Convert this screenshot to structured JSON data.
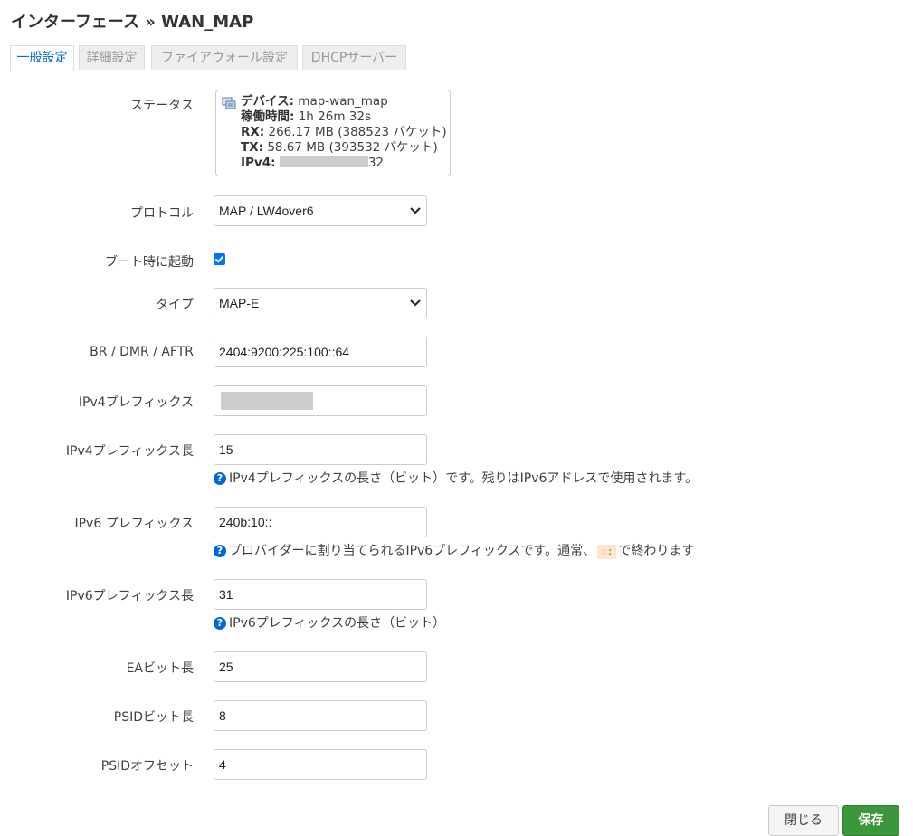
{
  "page": {
    "title": "インターフェース » WAN_MAP"
  },
  "tabs": [
    {
      "label": "一般設定"
    },
    {
      "label": "詳細設定"
    },
    {
      "label": "ファイアウォール設定"
    },
    {
      "label": "DHCPサーバー"
    }
  ],
  "status": {
    "label": "ステータス",
    "device_key": "デバイス:",
    "device_val": "map-wan_map",
    "uptime_key": "稼働時間:",
    "uptime_val": "1h 26m 32s",
    "rx_key": "RX:",
    "rx_val": "266.17 MB (388523 パケット)",
    "tx_key": "TX:",
    "tx_val": "58.67 MB (393532 パケット)",
    "ipv4_key": "IPv4:",
    "ipv4_suffix": "32"
  },
  "fields": {
    "protocol": {
      "label": "プロトコル",
      "value": "MAP / LW4over6"
    },
    "boot": {
      "label": "ブート時に起動",
      "checked": true
    },
    "type": {
      "label": "タイプ",
      "value": "MAP-E"
    },
    "br": {
      "label": "BR / DMR / AFTR",
      "value": "2404:9200:225:100::64"
    },
    "ipv4prefix": {
      "label": "IPv4プレフィックス"
    },
    "ipv4prefixlen": {
      "label": "IPv4プレフィックス長",
      "value": "15",
      "help": "IPv4プレフィックスの長さ（ビット）です。残りはIPv6アドレスで使用されます。"
    },
    "ipv6prefix": {
      "label": "IPv6 プレフィックス",
      "value": "240b:10::",
      "help_before": "プロバイダーに割り当てられるIPv6プレフィックスです。通常、",
      "help_code": "::",
      "help_after": "で終わります"
    },
    "ipv6prefixlen": {
      "label": "IPv6プレフィックス長",
      "value": "31",
      "help": "IPv6プレフィックスの長さ（ビット）"
    },
    "ealen": {
      "label": "EAビット長",
      "value": "25"
    },
    "psidlen": {
      "label": "PSIDビット長",
      "value": "8"
    },
    "psidoffset": {
      "label": "PSIDオフセット",
      "value": "4"
    }
  },
  "buttons": {
    "close": "閉じる",
    "save": "保存"
  },
  "colors": {
    "accent": "#0069d6",
    "save": "#3c963c"
  }
}
